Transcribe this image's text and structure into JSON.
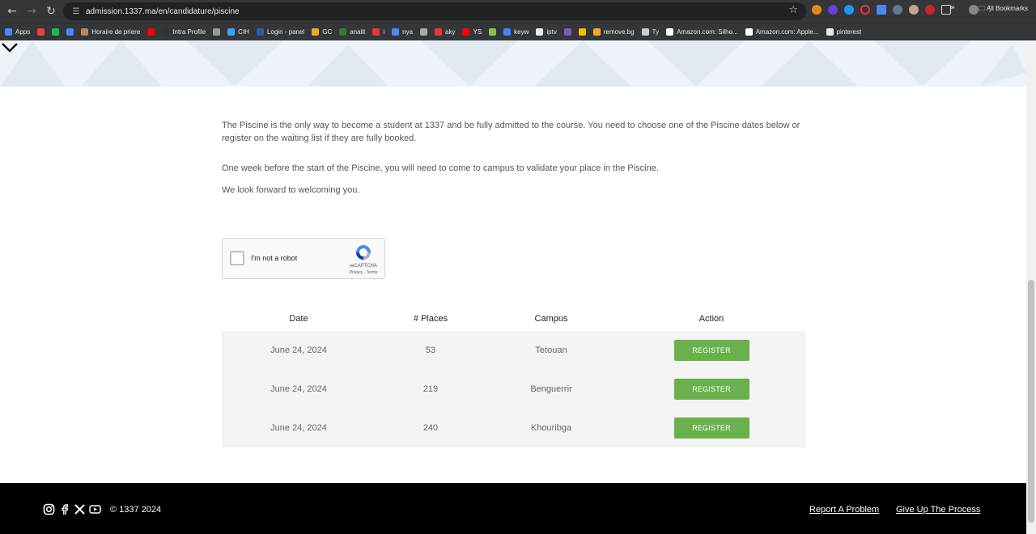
{
  "browser": {
    "url": "admission.1337.ma/en/candidature/piscine",
    "bookmarks": [
      {
        "label": "Apps",
        "color": "#4a8af4"
      },
      {
        "label": "",
        "color": "#ea4335"
      },
      {
        "label": "",
        "color": "#1db954"
      },
      {
        "label": "",
        "color": "#4a8af4"
      },
      {
        "label": "Horaire de priere",
        "color": "#b5895a"
      },
      {
        "label": "",
        "color": "#ff0000"
      },
      {
        "label": "Intra Profile",
        "color": "#333333"
      },
      {
        "label": "",
        "color": "#999999"
      },
      {
        "label": "CIH",
        "color": "#3ba3f3"
      },
      {
        "label": "Login - panel",
        "color": "#2a5db0"
      },
      {
        "label": "GC",
        "color": "#f5a623"
      },
      {
        "label": "analit",
        "color": "#2e7d32"
      },
      {
        "label": "i",
        "color": "#e53935"
      },
      {
        "label": "nya",
        "color": "#4a8af4"
      },
      {
        "label": "",
        "color": "#aaaaaa"
      },
      {
        "label": "aky",
        "color": "#e53935"
      },
      {
        "label": "YS",
        "color": "#ff0000"
      },
      {
        "label": "",
        "color": "#8bc34a"
      },
      {
        "label": "keyw",
        "color": "#4285f4"
      },
      {
        "label": "iptv",
        "color": "#e8eaed"
      },
      {
        "label": "",
        "color": "#7e57c2"
      },
      {
        "label": "",
        "color": "#fbbc05"
      },
      {
        "label": "remove.bg",
        "color": "#f9a825"
      },
      {
        "label": "Ty",
        "color": "#cccccc"
      },
      {
        "label": "Amazon.com: Silho...",
        "color": "#ffffff"
      },
      {
        "label": "Amazon.com: Apple...",
        "color": "#ffffff"
      },
      {
        "label": "pinterest",
        "color": "#e8eaed"
      }
    ],
    "more": "»",
    "all_bookmarks": "All Bookmarks"
  },
  "intro": {
    "p1": "The Piscine is the only way to become a student at 1337 and be fully admitted to the course. You need to choose one of the Piscine dates below or register on the waiting list if they are fully booked.",
    "p2": "One week before the start of the Piscine, you will need to come to campus to validate your place in the Piscine.",
    "p3": "We look forward to welcoming you."
  },
  "captcha": {
    "label": "I'm not a robot",
    "brand": "reCAPTCHA",
    "terms": "Privacy - Terms"
  },
  "table": {
    "headers": {
      "date": "Date",
      "places": "# Places",
      "campus": "Campus",
      "action": "Action"
    },
    "rows": [
      {
        "date": "June 24, 2024",
        "places": "53",
        "campus": "Tetouan",
        "action": "REGISTER"
      },
      {
        "date": "June 24, 2024",
        "places": "219",
        "campus": "Benguerrir",
        "action": "REGISTER"
      },
      {
        "date": "June 24, 2024",
        "places": "240",
        "campus": "Khouribga",
        "action": "REGISTER"
      }
    ]
  },
  "footer": {
    "copyright": "© 1337 2024",
    "report": "Report A Problem",
    "give_up": "Give Up The Process"
  },
  "colors": {
    "register_button": "#6ab04c",
    "footer_bg": "#000000",
    "table_bg": "#f3f3f3"
  }
}
